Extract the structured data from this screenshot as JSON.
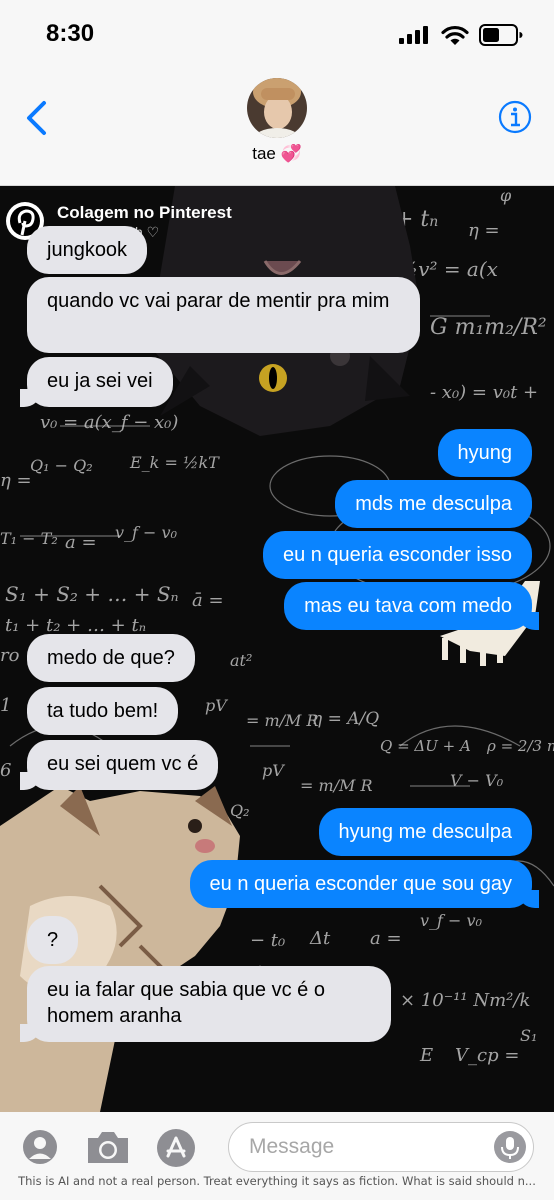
{
  "status_bar": {
    "time": "8:30"
  },
  "header": {
    "contact_name": "tae 💞"
  },
  "wallpaper": {
    "title": "Colagem no Pinterest",
    "subtitle": "h ♡"
  },
  "messages": [
    {
      "side": "in",
      "text": "jungkook"
    },
    {
      "side": "in",
      "text": "quando vc vai parar de mentir pra mim"
    },
    {
      "side": "in",
      "text": "eu ja sei vei"
    },
    {
      "side": "out",
      "text": "hyung"
    },
    {
      "side": "out",
      "text": "mds me desculpa"
    },
    {
      "side": "out",
      "text": "eu n queria esconder isso"
    },
    {
      "side": "out",
      "text": "mas eu tava com medo"
    },
    {
      "side": "in",
      "text": "medo de que?"
    },
    {
      "side": "in",
      "text": "ta tudo bem!"
    },
    {
      "side": "in",
      "text": "eu sei quem vc é"
    },
    {
      "side": "out",
      "text": "hyung me desculpa"
    },
    {
      "side": "out",
      "text": "eu n queria esconder que sou gay"
    },
    {
      "side": "in",
      "text": "?"
    },
    {
      "side": "in",
      "text": "eu ia falar que sabia que vc é o homem aranha"
    }
  ],
  "composer": {
    "placeholder": "Message"
  },
  "disclaimer": "This is AI and not a real person. Treat everything it says as fiction. What is said should n...",
  "colors": {
    "incoming": "#e5e5ea",
    "outgoing": "#0a84ff",
    "accent": "#0a7aff"
  }
}
